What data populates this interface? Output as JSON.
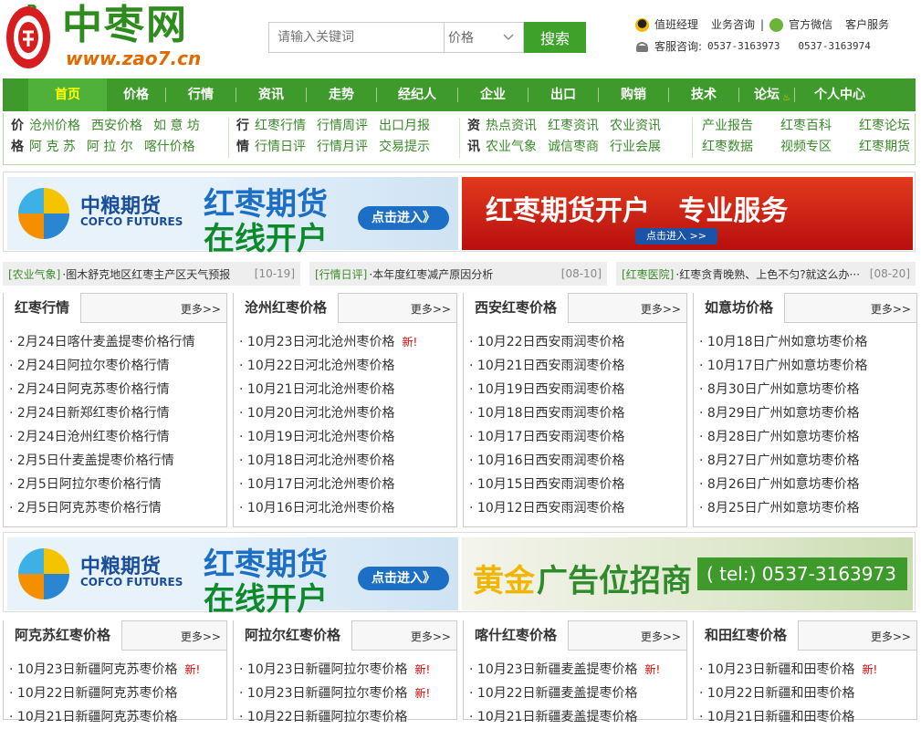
{
  "header": {
    "logo_text": "中枣网",
    "logo_url": "www.zao7.cn",
    "search_placeholder": "请输入关键词",
    "search_select": "价格",
    "search_button": "搜索",
    "top_links": [
      "值班经理",
      "业务咨询",
      "|",
      "官方微信",
      "客户服务"
    ],
    "hotline_label": "客服咨询:",
    "hotline_numbers": "0537-3163973   0537-3163974"
  },
  "nav": [
    "首页",
    "价格",
    "行情",
    "资讯",
    "走势",
    "经纪人",
    "企业",
    "出口",
    "购销",
    "技术",
    "论坛",
    "个人中心"
  ],
  "subnav": {
    "price_row1": [
      "沧州价格",
      "西安价格",
      "如 意 坊"
    ],
    "price_row2": [
      "阿 克 苏",
      "阿 拉 尔",
      "喀什价格"
    ],
    "price_label1": "价",
    "price_label2": "格",
    "market_label1": "行",
    "market_label2": "情",
    "market_row1": [
      "红枣行情",
      "行情周评",
      "出口月报"
    ],
    "market_row2": [
      "行情日评",
      "行情月评",
      "交易提示"
    ],
    "news_label1": "资",
    "news_label2": "讯",
    "news_row1": [
      "热点资讯",
      "红枣资讯",
      "农业资讯"
    ],
    "news_row2": [
      "农业气象",
      "诚信枣商",
      "行业会展"
    ],
    "extra_row1": [
      "产业报告",
      "红枣百科",
      "红枣论坛"
    ],
    "extra_row2": [
      "红枣数据",
      "视频专区",
      "红枣期货"
    ]
  },
  "banners": {
    "cofco_brand": "中粮期货",
    "cofco_en": "COFCO FUTURES",
    "cofco_title1": "红枣期货",
    "cofco_title2": "在线开户",
    "cofco_btn": "点击进入》",
    "right1_text": "红枣期货开户   专业服务",
    "right1_btn": "点击进入 >>",
    "right2_text1": "黄金",
    "right2_text2": "广告位招商",
    "right2_tel": "( tel:) 0537-3163973"
  },
  "notices": [
    {
      "tag": "[农业气象]",
      "text": "·图木舒克地区红枣主产区天气预报",
      "date": "[10-19]"
    },
    {
      "tag": "[行情日评]",
      "text": "·本年度红枣减产原因分析",
      "date": "[08-10]"
    },
    {
      "tag": "[红枣医院]",
      "text": "·红枣贪青晚熟、上色不匀?就这么办···",
      "date": "[08-20]"
    }
  ],
  "more_label": "更多>>",
  "new_label": "新!",
  "boxes_row1": [
    {
      "title": "红枣行情",
      "items": [
        "2月24日喀什麦盖提枣价格行情",
        "2月24日阿拉尔枣价格行情",
        "2月24日阿克苏枣价格行情",
        "2月24日新郑红枣价格行情",
        "2月24日沧州红枣价格行情",
        "2月5日什麦盖提枣价格行情",
        "2月5日阿拉尔枣价格行情",
        "2月5日阿克苏枣价格行情"
      ]
    },
    {
      "title": "沧州红枣价格",
      "items": [
        "10月23日河北沧州枣价格",
        "10月22日河北沧州枣价格",
        "10月21日河北沧州枣价格",
        "10月20日河北沧州枣价格",
        "10月19日河北沧州枣价格",
        "10月18日河北沧州枣价格",
        "10月17日河北沧州枣价格",
        "10月16日河北沧州枣价格"
      ]
    },
    {
      "title": "西安红枣价格",
      "items": [
        "10月22日西安雨润枣价格",
        "10月21日西安雨润枣价格",
        "10月19日西安雨润枣价格",
        "10月18日西安雨润枣价格",
        "10月17日西安雨润枣价格",
        "10月16日西安雨润枣价格",
        "10月15日西安雨润枣价格",
        "10月12日西安雨润枣价格"
      ]
    },
    {
      "title": "如意坊价格",
      "items": [
        "10月18日广州如意坊枣价格",
        "10月17日广州如意坊枣价格",
        "8月30日广州如意坊枣价格",
        "8月29日广州如意坊枣价格",
        "8月28日广州如意坊枣价格",
        "8月27日广州如意坊枣价格",
        "8月26日广州如意坊枣价格",
        "8月25日广州如意坊枣价格"
      ]
    }
  ],
  "boxes_row2": [
    {
      "title": "阿克苏红枣价格",
      "items": [
        "10月23日新疆阿克苏枣价格",
        "10月22日新疆阿克苏枣价格",
        "10月21日新疆阿克苏枣价格"
      ]
    },
    {
      "title": "阿拉尔红枣价格",
      "items": [
        "10月23日新疆阿拉尔枣价格",
        "10月23日新疆阿拉尔枣价格",
        "10月22日新疆阿拉尔枣价格"
      ]
    },
    {
      "title": "喀什红枣价格",
      "items": [
        "10月23日新疆麦盖提枣价格",
        "10月22日新疆麦盖提枣价格",
        "10月21日新疆麦盖提枣价格"
      ]
    },
    {
      "title": "和田红枣价格",
      "items": [
        "10月23日新疆和田枣价格",
        "10月22日新疆和田枣价格",
        "10月21日新疆和田枣价格"
      ]
    }
  ]
}
